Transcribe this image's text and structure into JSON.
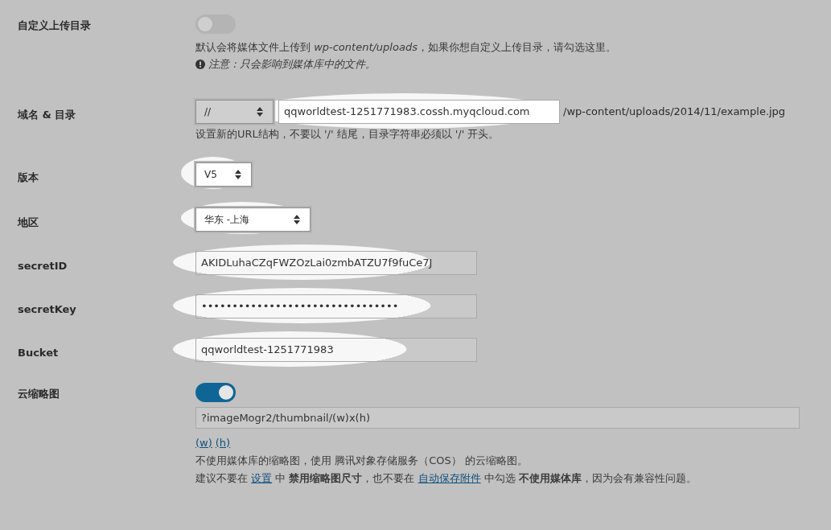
{
  "rows": [
    {
      "kind": "toggle",
      "label": "自定义上传目录",
      "on": false,
      "description": "默认会将媒体文件上传到 *wp-content/uploads*，如果你想自定义上传目录，请勾选这里。",
      "note": "注意：只会影响到媒体库中的文件。"
    },
    {
      "kind": "domain",
      "label": "域名 & 目录",
      "protocol": "//",
      "value": "qqworldtest-1251771983.cossh.myqcloud.com",
      "highlighted": true,
      "suffix": "/wp-content/uploads/2014/11/example.jpg",
      "hint": "设置新的URL结构，不要以 '/' 结尾，目录字符串必须以 '/' 开头。"
    },
    {
      "kind": "select",
      "label": "版本",
      "value": "V5",
      "highlighted": true
    },
    {
      "kind": "select",
      "label": "地区",
      "value": "华东 -上海",
      "highlighted": true
    },
    {
      "kind": "text",
      "label": "secretID",
      "value": "AKIDLuhaCZqFWZOzLai0zmbATZU7f9fuCe7J",
      "highlighted": true
    },
    {
      "kind": "password",
      "label": "secretKey",
      "value": "••••••••••••••••••••••••••••••••",
      "highlighted": true
    },
    {
      "kind": "text",
      "label": "Bucket",
      "value": "qqworldtest-1251771983",
      "highlighted": true
    },
    {
      "kind": "thumbnail",
      "label": "云缩略图",
      "on": true,
      "value": "?imageMogr2/thumbnail/(w)x(h)",
      "tokens": [
        "(w)",
        "(h)"
      ],
      "lines": [
        [
          {
            "kind": "plain",
            "text": "不使用媒体库的缩略图，使用 腾讯对象存储服务（COS） 的云缩略图。"
          }
        ],
        [
          {
            "kind": "plain",
            "text": "建议不要在 "
          },
          {
            "kind": "link",
            "text": "设置"
          },
          {
            "kind": "plain",
            "text": " 中 **禁用缩略图尺寸**，也不要在 "
          },
          {
            "kind": "link",
            "text": "自动保存附件"
          },
          {
            "kind": "plain",
            "text": " 中勾选 **不使用媒体库**，因为会有兼容性问题。"
          }
        ]
      ]
    }
  ]
}
